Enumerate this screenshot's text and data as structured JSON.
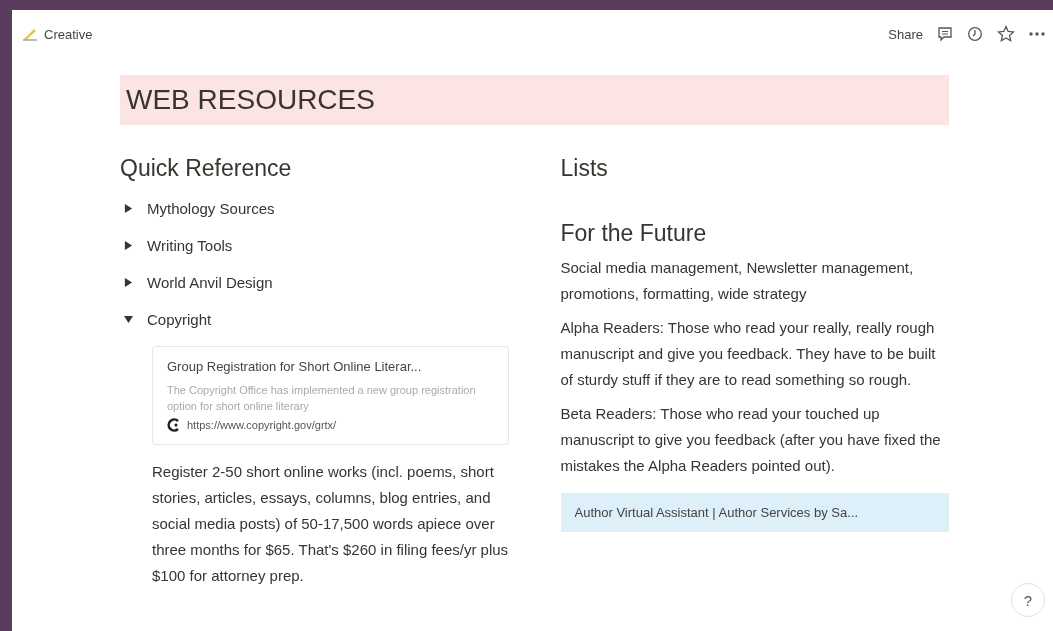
{
  "topbar": {
    "breadcrumb": "Creative",
    "share": "Share"
  },
  "page": {
    "title": "WEB RESOURCES"
  },
  "left": {
    "heading": "Quick Reference",
    "toggles": [
      {
        "label": "Mythology Sources",
        "expanded": false
      },
      {
        "label": "Writing Tools",
        "expanded": false
      },
      {
        "label": "World Anvil Design",
        "expanded": false
      },
      {
        "label": "Copyright",
        "expanded": true
      }
    ],
    "bookmark": {
      "title": "Group Registration for Short Online Literar...",
      "description": "The Copyright Office has implemented a new group registration option for short online literary",
      "url": "https://www.copyright.gov/grtx/"
    },
    "paragraph": "Register 2-50 short online works (incl. poems, short stories, articles, essays, columns, blog entries, and social media posts) of 50-17,500 words apiece over three months for $65. That's $260 in filing fees/yr plus $100 for attorney prep."
  },
  "right": {
    "heading": "Lists",
    "subheading": "For the Future",
    "paragraphs": [
      "Social media management, Newsletter management, promotions, formatting, wide strategy",
      "Alpha Readers: Those who read your really, really rough manuscript and give you feedback. They have to be built of sturdy stuff if they are to read something so rough.",
      "Beta Readers: Those who read your touched up manuscript to give you feedback (after you have fixed the mistakes the Alpha Readers pointed out)."
    ],
    "callout": "Author Virtual Assistant | Author Services by Sa..."
  },
  "help": "?"
}
